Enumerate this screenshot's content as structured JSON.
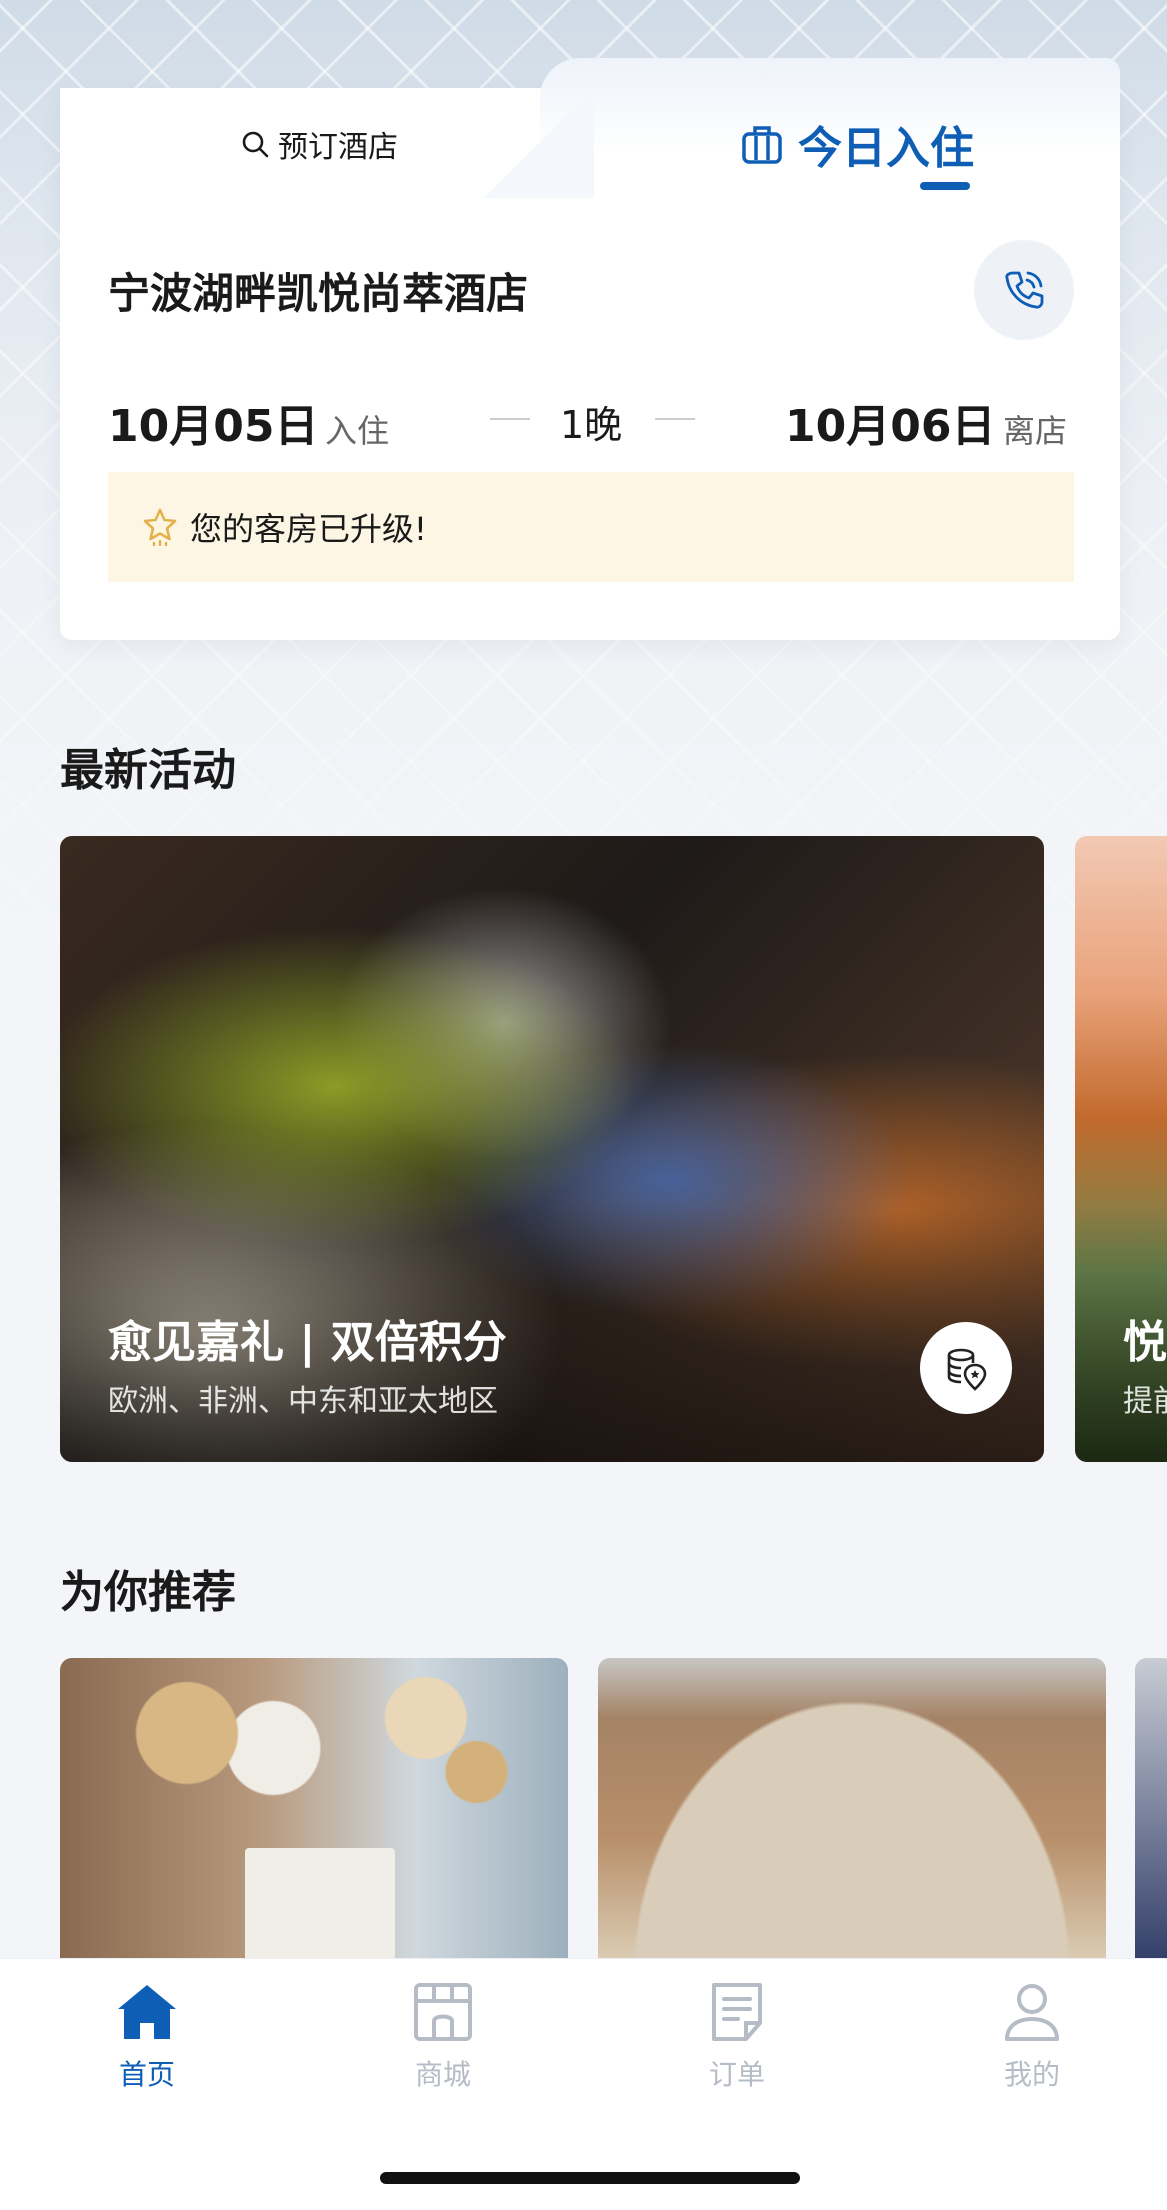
{
  "colors": {
    "accent": "#0f5eb5",
    "upgrade_bg": "#fdf6e4",
    "inactive": "#b6bcc6"
  },
  "booking_card": {
    "tab_book": {
      "label": "预订酒店",
      "icon": "search-icon"
    },
    "tab_today": {
      "label": "今日入住",
      "icon": "luggage-icon"
    },
    "hotel_name": "宁波湖畔凯悦尚萃酒店",
    "phone_icon": "phone-icon",
    "checkin_date": "10月05日",
    "checkin_label": "入住",
    "nights": "1晚",
    "checkout_date": "10月06日",
    "checkout_label": "离店",
    "upgrade_icon": "star-icon",
    "upgrade_text": "您的客房已升级!"
  },
  "latest": {
    "title": "最新活动",
    "promos": [
      {
        "title": "愈见嘉礼 | 双倍积分",
        "subtitle": "欧洲、非洲、中东和亚太地区",
        "badge_icon": "points-badge-icon"
      },
      {
        "title": "悦",
        "subtitle": "提前"
      }
    ]
  },
  "recommend": {
    "title": "为你推荐"
  },
  "tabbar": {
    "items": [
      {
        "label": "首页",
        "icon": "home-icon",
        "active": true
      },
      {
        "label": "商城",
        "icon": "store-icon",
        "active": false
      },
      {
        "label": "订单",
        "icon": "order-icon",
        "active": false
      },
      {
        "label": "我的",
        "icon": "profile-icon",
        "active": false
      }
    ]
  }
}
